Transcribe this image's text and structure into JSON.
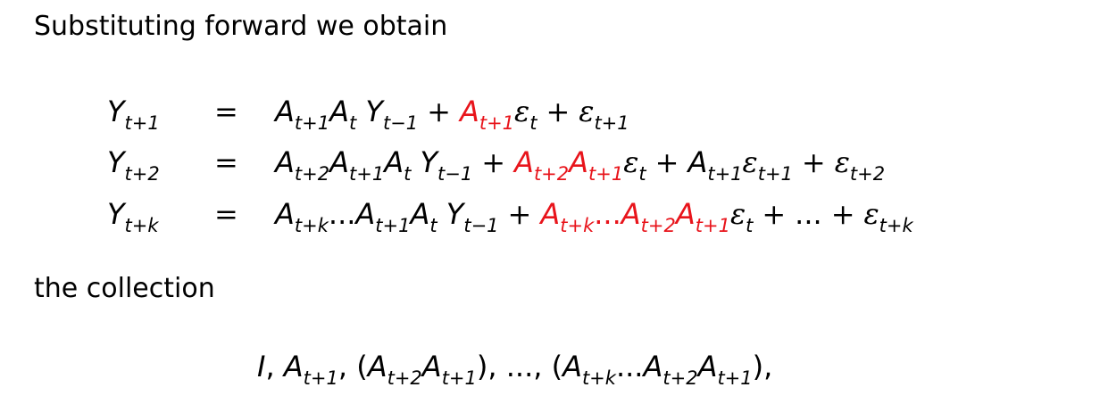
{
  "intro_text": "Substituting forward we obtain",
  "equations": [
    {
      "lhs": "Y_{t+1}",
      "rel": "=",
      "rhs": "A_{t+1}A_t Y_{t−1} + A_{t+1}ε_t + ε_{t+1}",
      "highlight": "A_{t+1}"
    },
    {
      "lhs": "Y_{t+2}",
      "rel": "=",
      "rhs": "A_{t+2}A_{t+1}A_t Y_{t−1} + A_{t+2}A_{t+1}ε_t + A_{t+1}ε_{t+1} + ε_{t+2}",
      "highlight": "A_{t+2}A_{t+1}"
    },
    {
      "lhs": "Y_{t+k}",
      "rel": "=",
      "rhs": "A_{t+k}...A_{t+1}A_t Y_{t−1} + A_{t+k}...A_{t+2}A_{t+1}ε_t + ... + ε_{t+k}",
      "highlight": "A_{t+k}...A_{t+2}A_{t+1}"
    }
  ],
  "collection_text": "the collection",
  "collection_formula": "I, A_{t+1}, (A_{t+2}A_{t+1}), ..., (A_{t+k}...A_{t+2}A_{t+1}),",
  "highlight_color": "#e8141b"
}
